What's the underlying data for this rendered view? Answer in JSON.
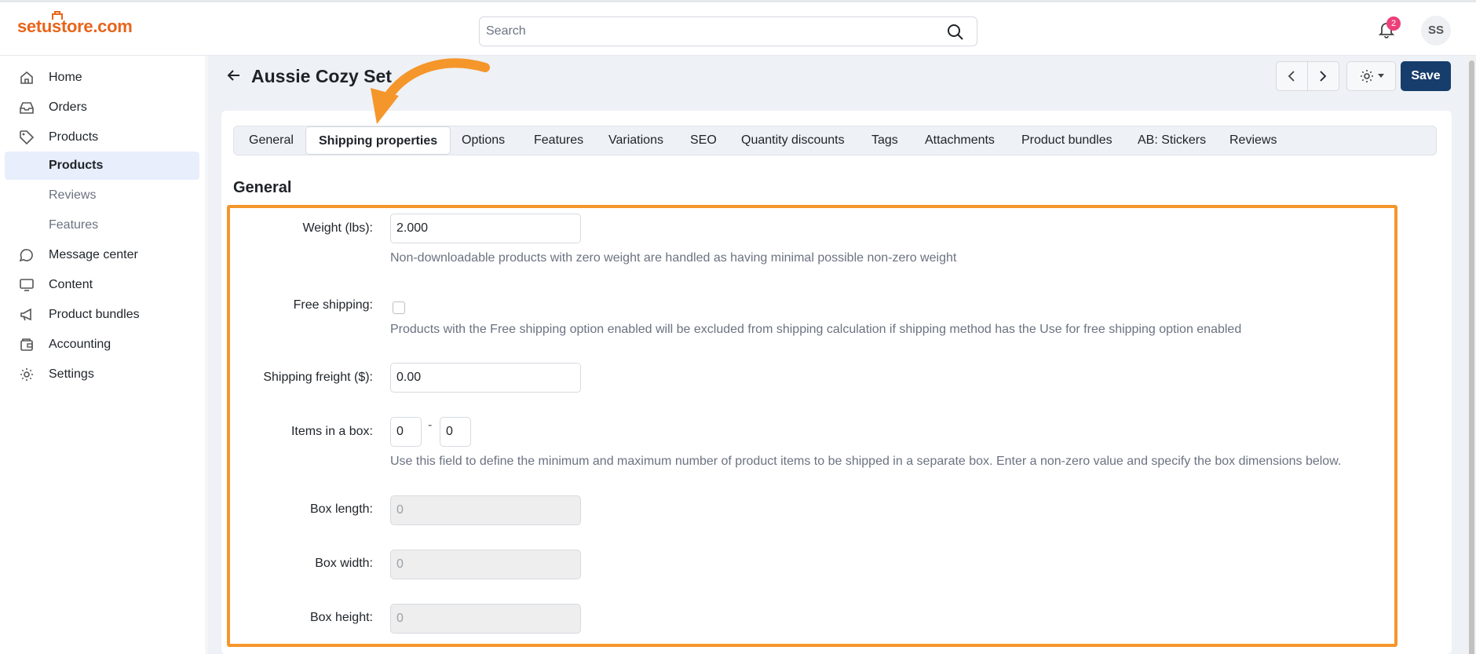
{
  "header": {
    "logo_text": "setustore.com",
    "search_placeholder": "Search",
    "notification_count": "2",
    "user_initials": "SS"
  },
  "sidebar": {
    "items": [
      {
        "label": "Home",
        "icon": "home-icon"
      },
      {
        "label": "Orders",
        "icon": "inbox-icon"
      },
      {
        "label": "Products",
        "icon": "tag-icon"
      },
      {
        "label": "Products",
        "sub": true,
        "active": true
      },
      {
        "label": "Reviews",
        "sub": true
      },
      {
        "label": "Features",
        "sub": true
      },
      {
        "label": "Message center",
        "icon": "chat-icon"
      },
      {
        "label": "Content",
        "icon": "monitor-icon"
      },
      {
        "label": "Product bundles",
        "icon": "megaphone-icon"
      },
      {
        "label": "Accounting",
        "icon": "wallet-icon"
      },
      {
        "label": "Settings",
        "icon": "gear-icon"
      }
    ]
  },
  "page": {
    "title": "Aussie Cozy Set",
    "save_label": "Save"
  },
  "tabs": [
    "General",
    "Shipping properties",
    "Options",
    "Features",
    "Variations",
    "SEO",
    "Quantity discounts",
    "Tags",
    "Attachments",
    "Product bundles",
    "AB: Stickers",
    "Reviews"
  ],
  "active_tab": "Shipping properties",
  "section": {
    "title": "General"
  },
  "form": {
    "weight": {
      "label": "Weight (lbs):",
      "value": "2.000",
      "help": "Non-downloadable products with zero weight are handled as having minimal possible non-zero weight"
    },
    "free_shipping": {
      "label": "Free shipping:",
      "checked": false,
      "help": "Products with the Free shipping option enabled will be excluded from shipping calculation if shipping method has the Use for free shipping option enabled"
    },
    "shipping_freight": {
      "label": "Shipping freight ($):",
      "value": "0.00"
    },
    "items_in_box": {
      "label": "Items in a box:",
      "min": "0",
      "separator": "-",
      "max": "0",
      "help": "Use this field to define the minimum and maximum number of product items to be shipped in a separate box. Enter a non-zero value and specify the box dimensions below."
    },
    "box_length": {
      "label": "Box length:",
      "value": "0"
    },
    "box_width": {
      "label": "Box width:",
      "value": "0"
    },
    "box_height": {
      "label": "Box height:",
      "value": "0"
    }
  },
  "colors": {
    "brand": "#e8641b",
    "save_button": "#163d6b",
    "highlight": "#f5962b",
    "badge": "#ec407a"
  }
}
